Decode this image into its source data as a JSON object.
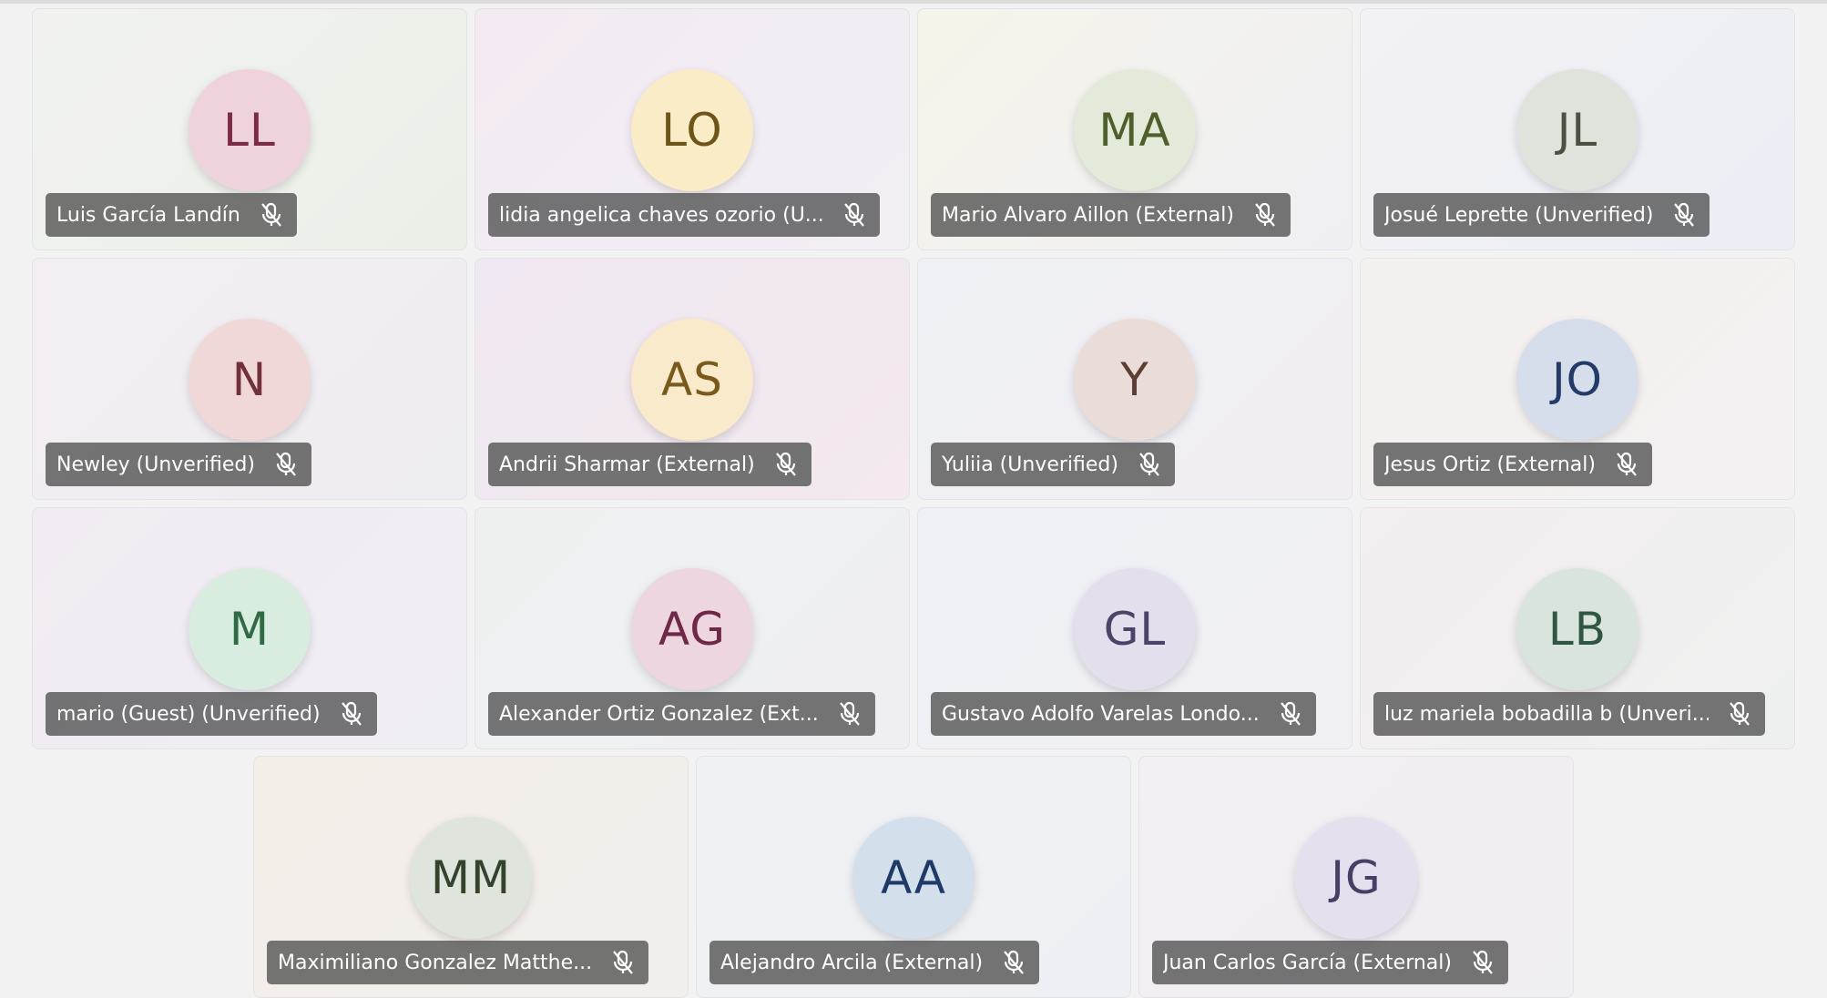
{
  "participants": [
    {
      "initials": "LL",
      "name": "Luis García Landín",
      "avatar_bg": "#efd3dc",
      "avatar_fg": "#7a2c46",
      "tile_bg": [
        "#f1f2ee",
        "#ecefe8"
      ],
      "muted": true
    },
    {
      "initials": "LO",
      "name": "lidia angelica chaves ozorio (U...",
      "avatar_bg": "#f9ecc6",
      "avatar_fg": "#6d5418",
      "tile_bg": [
        "#f4eaf3",
        "#f1eef4"
      ],
      "muted": true
    },
    {
      "initials": "MA",
      "name": "Mario Alvaro Aillon (External)",
      "avatar_bg": "#e4ead9",
      "avatar_fg": "#4e5f2b",
      "tile_bg": [
        "#f5f4ea",
        "#efeff3"
      ],
      "muted": true
    },
    {
      "initials": "JL",
      "name": "Josué Leprette (Unverified)",
      "avatar_bg": "#dfe3dc",
      "avatar_fg": "#4a5140",
      "tile_bg": [
        "#f2f1f5",
        "#eceef5"
      ],
      "muted": true
    },
    {
      "initials": "N",
      "name": "Newley (Unverified)",
      "avatar_bg": "#f0d8d8",
      "avatar_fg": "#72303a",
      "tile_bg": [
        "#f3eef2",
        "#eeedf1"
      ],
      "muted": true
    },
    {
      "initials": "AS",
      "name": "Andrii Sharmar (External)",
      "avatar_bg": "#f8eacb",
      "avatar_fg": "#7a5a1c",
      "tile_bg": [
        "#efe7f1",
        "#f3e9ee"
      ],
      "muted": true
    },
    {
      "initials": "Y",
      "name": "Yuliia (Unverified)",
      "avatar_bg": "#eadcd8",
      "avatar_fg": "#5c3e32",
      "tile_bg": [
        "#eef0f5",
        "#f1eef2"
      ],
      "muted": true
    },
    {
      "initials": "JO",
      "name": "Jesus Ortiz (External)",
      "avatar_bg": "#d5deea",
      "avatar_fg": "#233b66",
      "tile_bg": [
        "#f4f0ee",
        "#f3f1f2"
      ],
      "muted": true
    },
    {
      "initials": "M",
      "name": "mario (Guest) (Unverified)",
      "avatar_bg": "#d8ecdf",
      "avatar_fg": "#2f6a45",
      "tile_bg": [
        "#f2ebf3",
        "#efeef4"
      ],
      "muted": true
    },
    {
      "initials": "AG",
      "name": "Alexander Ortiz Gonzalez (Ext...",
      "avatar_bg": "#edd6e0",
      "avatar_fg": "#6e2848",
      "tile_bg": [
        "#eef0f0",
        "#efeff3"
      ],
      "muted": true
    },
    {
      "initials": "GL",
      "name": "Gustavo Adolfo Varelas Londo...",
      "avatar_bg": "#e3dfec",
      "avatar_fg": "#4a4468",
      "tile_bg": [
        "#eef0f5",
        "#f0eff4"
      ],
      "muted": true
    },
    {
      "initials": "LB",
      "name": "luz mariela bobadilla b (Unveri...",
      "avatar_bg": "#d9e4dc",
      "avatar_fg": "#2e5640",
      "tile_bg": [
        "#f3eef0",
        "#eef0ef"
      ],
      "muted": true
    },
    {
      "initials": "MM",
      "name": "Maximiliano Gonzalez Matthe...",
      "avatar_bg": "#dfe5dc",
      "avatar_fg": "#33432c",
      "tile_bg": [
        "#f4eee8",
        "#f1eeec"
      ],
      "muted": true
    },
    {
      "initials": "AA",
      "name": "Alejandro Arcila (External)",
      "avatar_bg": "#d4dfec",
      "avatar_fg": "#1e3a66",
      "tile_bg": [
        "#eff1f3",
        "#eeeff4"
      ],
      "muted": true
    },
    {
      "initials": "JG",
      "name": "Juan Carlos García (External)",
      "avatar_bg": "#e4e0ee",
      "avatar_fg": "#474066",
      "tile_bg": [
        "#f3eff2",
        "#efeef3"
      ],
      "muted": true
    }
  ]
}
